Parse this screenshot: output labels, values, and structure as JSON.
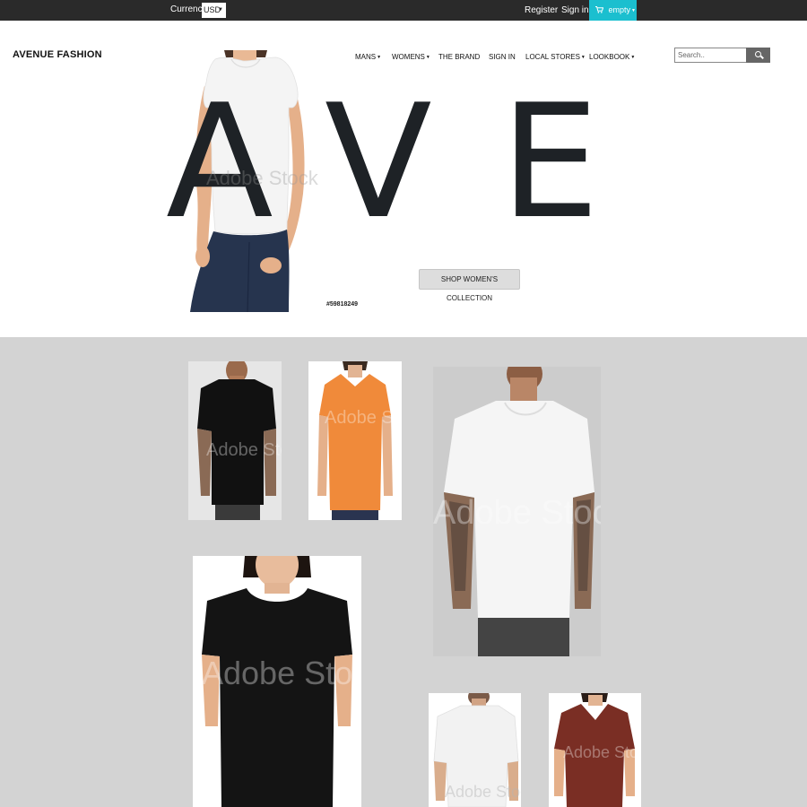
{
  "topbar": {
    "currency_label": "Currency:",
    "currency_value": "USD",
    "register": "Register",
    "sign_in": "Sign in",
    "cart_label": "empty"
  },
  "header": {
    "logo": "AVENUE FASHION",
    "nav": {
      "mans": "MANS",
      "womens": "WOMENS",
      "the_brand": "THE BRAND",
      "sign_in": "SIGN IN",
      "local_stores": "LOCAL STORES",
      "lookbook": "LOOKBOOK"
    },
    "search_placeholder": "Search.."
  },
  "hero": {
    "letter_1": "A",
    "letter_2": "V",
    "letter_3": "E",
    "watermark": "Adobe Stock",
    "button": "SHOP WOMEN'S COLLECTION",
    "code": "#59818249"
  },
  "gallery": {
    "watermark": "Adobe Stock",
    "items": [
      {
        "alt": "Man in black t-shirt",
        "shirt_color": "#111111"
      },
      {
        "alt": "Woman in orange t-shirt",
        "shirt_color": "#f08a3a"
      },
      {
        "alt": "Man in white t-shirt",
        "shirt_color": "#f5f5f5"
      },
      {
        "alt": "Woman in black t-shirt",
        "shirt_color": "#141414"
      },
      {
        "alt": "Man in white t-shirt",
        "shirt_color": "#f2f2f2"
      },
      {
        "alt": "Woman in maroon t-shirt",
        "shirt_color": "#7a2e24"
      }
    ]
  },
  "colors": {
    "topbar_bg": "#2a2a2a",
    "cart_accent": "#1bbfcf",
    "gallery_bg": "#d3d3d3",
    "hero_text": "#1e2226"
  }
}
